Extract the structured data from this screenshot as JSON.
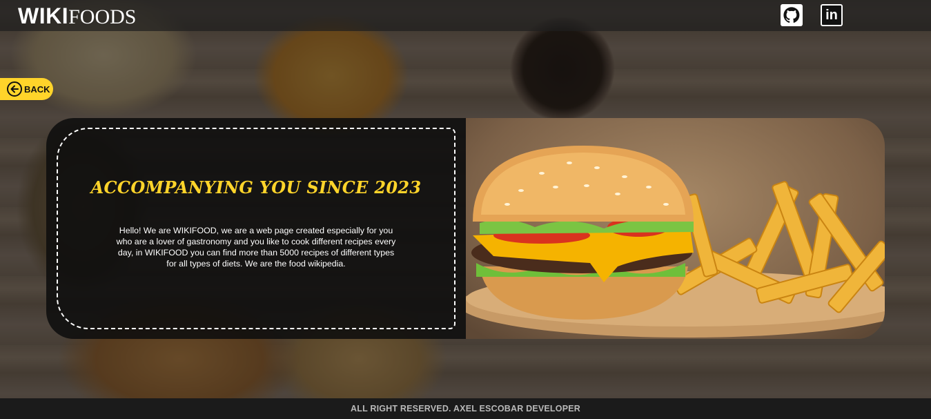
{
  "header": {
    "logo_bold": "WIKI",
    "logo_light": "FOODS",
    "social": [
      {
        "name": "github",
        "icon": "github-icon"
      },
      {
        "name": "linkedin",
        "icon": "linkedin-icon",
        "glyph": "in"
      }
    ]
  },
  "back_button": {
    "label": "BACK",
    "icon": "arrow-left-circle-icon",
    "color": "#ffd42a"
  },
  "about": {
    "title": "ACCOMPANYING YOU SINCE 2023",
    "body": "Hello! We are WIKIFOOD, we are a web page created especially for you who are a lover of gastronomy and you like to cook different recipes every day, in WIKIFOOD you can find more than 5000 recipes of different types for all types of diets. We are the food wikipedia.",
    "title_color": "#ffd42a"
  },
  "hero_image": {
    "subject": "burger-and-fries-image"
  },
  "footer": {
    "text": "ALL RIGHT RESERVED. AXEL ESCOBAR DEVELOPER"
  },
  "colors": {
    "accent": "#ffd42a",
    "header_bg": "#1e1e1e",
    "footer_bg": "#1b1b1b",
    "card_bg": "#0e0e0e"
  }
}
